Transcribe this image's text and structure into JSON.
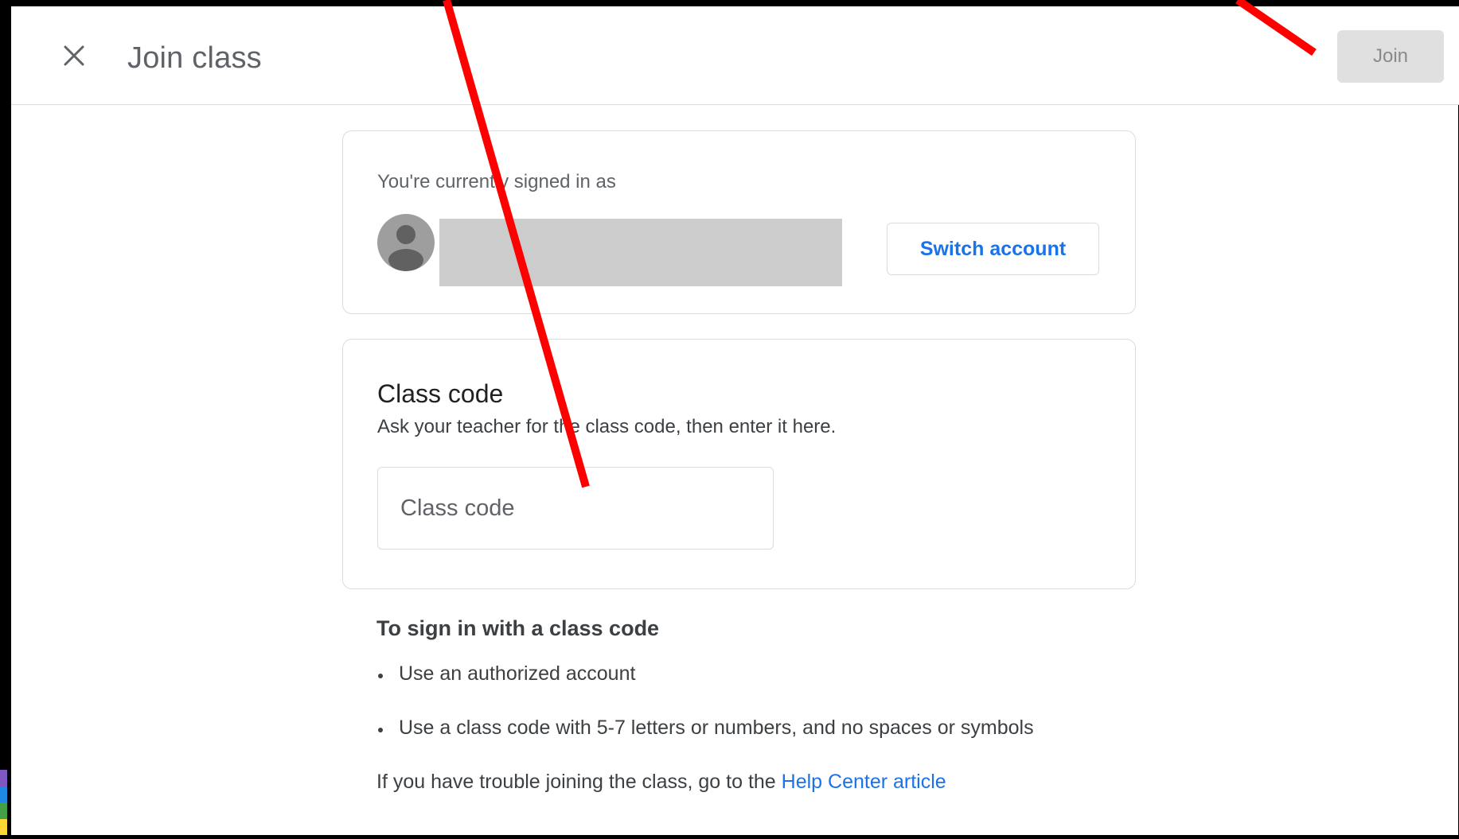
{
  "header": {
    "title": "Join class",
    "join_label": "Join"
  },
  "account": {
    "signed_in_label": "You're currently signed in as",
    "switch_account_label": "Switch account"
  },
  "class_code": {
    "title": "Class code",
    "description": "Ask your teacher for the class code, then enter it here.",
    "input_placeholder": "Class code",
    "input_value": ""
  },
  "help": {
    "title": "To sign in with a class code",
    "items": [
      "Use an authorized account",
      "Use a class code with 5-7 letters or numbers, and no spaces or symbols"
    ],
    "trouble_text": "If you have trouble joining the class, go to the ",
    "link_label": "Help Center article"
  },
  "icons": {
    "close": "close-icon",
    "avatar": "person-icon"
  },
  "colors": {
    "accent": "#1a73e8",
    "annotation": "#ff0000",
    "join_disabled_bg": "#e0e0e0",
    "redacted": "#cccccc"
  }
}
